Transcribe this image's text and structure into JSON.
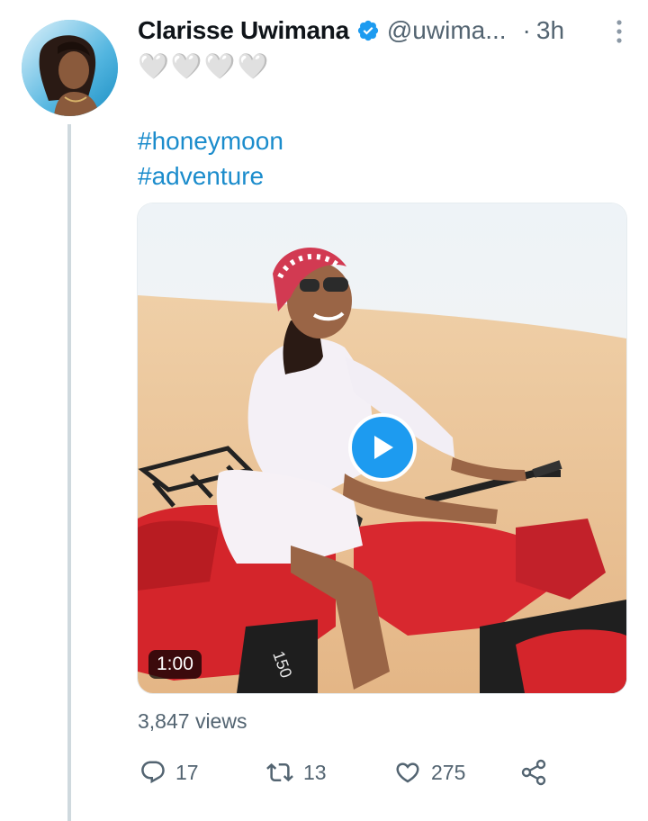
{
  "tweet": {
    "author": {
      "display_name": "Clarisse Uwimana",
      "handle": "@uwima...",
      "verified": true,
      "bio_emoji": "🤍🤍🤍🤍"
    },
    "separator": "·",
    "timestamp": "3h",
    "hashtags": [
      "#honeymoon",
      "#adventure"
    ],
    "media": {
      "type": "video",
      "duration": "1:00",
      "play_icon": "play-icon"
    },
    "views": "3,847 views",
    "actions": {
      "reply_count": "17",
      "retweet_count": "13",
      "like_count": "275"
    },
    "icons": {
      "verified": "verified-badge-icon",
      "more": "more-vertical-icon",
      "reply": "reply-icon",
      "retweet": "retweet-icon",
      "like": "heart-icon",
      "share": "share-icon"
    },
    "colors": {
      "link": "#1b8ccc",
      "accent": "#1d9bf0",
      "secondary_text": "#536471",
      "thread_line": "#cfd9de"
    }
  }
}
